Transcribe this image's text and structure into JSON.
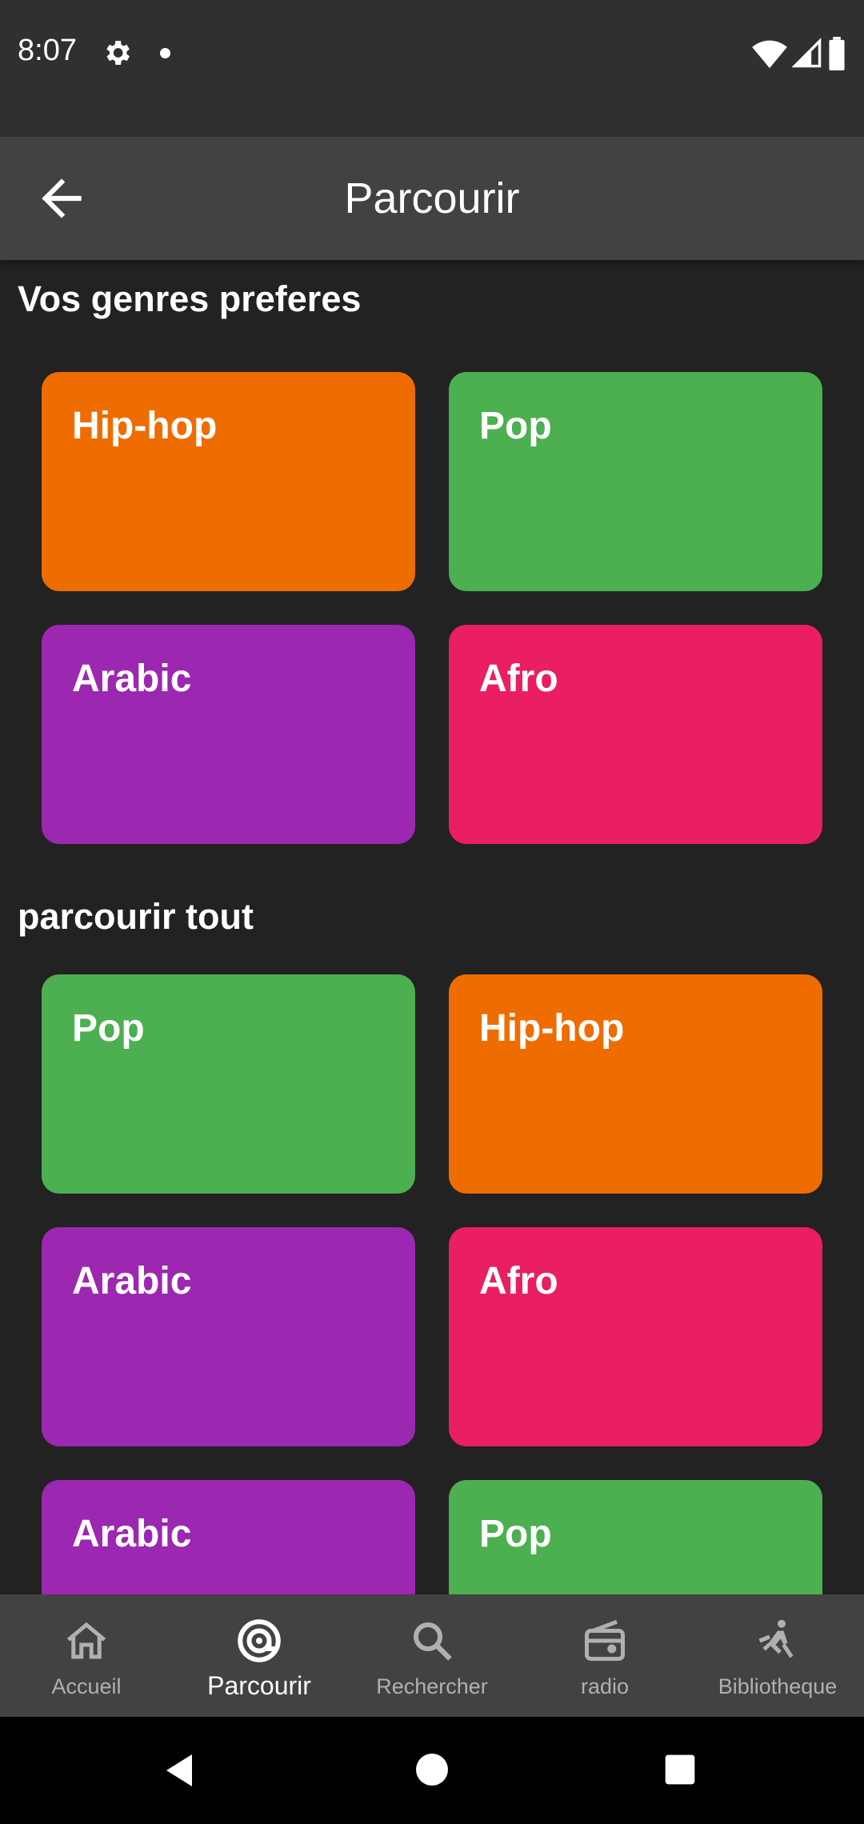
{
  "status_bar": {
    "time": "8:07"
  },
  "app_bar": {
    "title": "Parcourir"
  },
  "sections": {
    "favorites": {
      "title": "Vos genres preferes",
      "cards": [
        {
          "label": "Hip-hop",
          "color": "#EF6C00"
        },
        {
          "label": "Pop",
          "color": "#4CAF50"
        },
        {
          "label": "Arabic",
          "color": "#9C27B0"
        },
        {
          "label": "Afro",
          "color": "#E91E63"
        }
      ]
    },
    "browse_all": {
      "title": "parcourir tout",
      "cards": [
        {
          "label": "Pop",
          "color": "#4CAF50"
        },
        {
          "label": "Hip-hop",
          "color": "#EF6C00"
        },
        {
          "label": "Arabic",
          "color": "#9C27B0"
        },
        {
          "label": "Afro",
          "color": "#E91E63"
        },
        {
          "label": "Arabic",
          "color": "#9C27B0"
        },
        {
          "label": "Pop",
          "color": "#4CAF50"
        }
      ]
    }
  },
  "bottom_nav": {
    "items": [
      {
        "label": "Accueil",
        "icon": "home-icon"
      },
      {
        "label": "Parcourir",
        "icon": "browse-icon",
        "active": true
      },
      {
        "label": "Rechercher",
        "icon": "search-icon"
      },
      {
        "label": "radio",
        "icon": "radio-icon"
      },
      {
        "label": "Bibliotheque",
        "icon": "library-icon"
      }
    ]
  }
}
